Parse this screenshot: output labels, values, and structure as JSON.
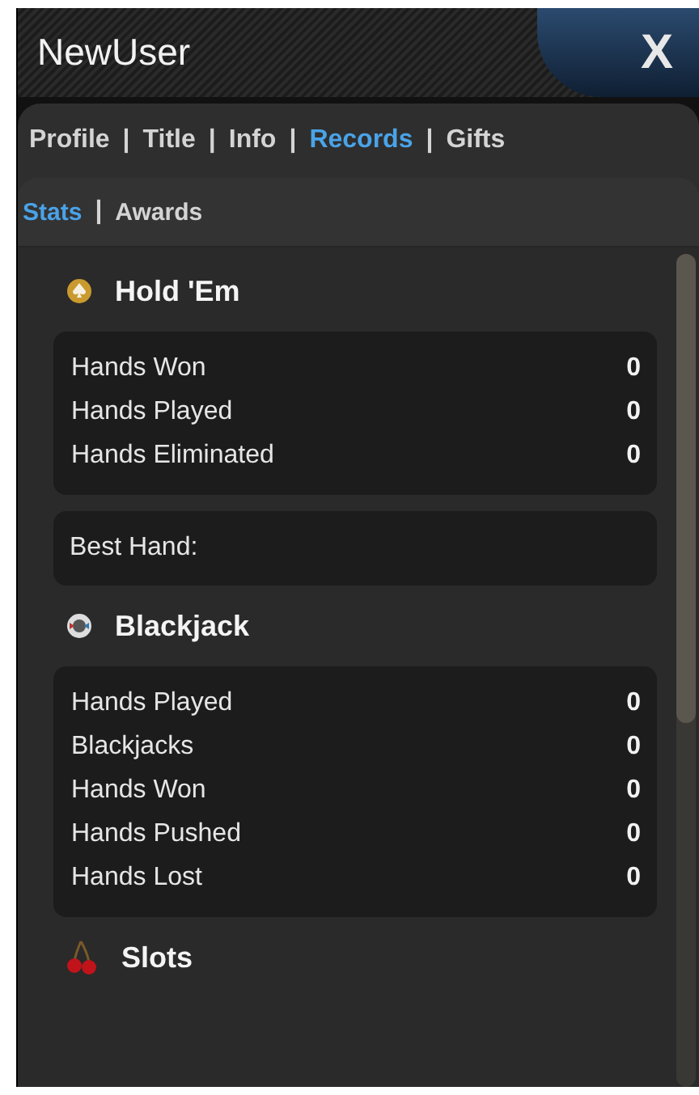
{
  "window": {
    "title": "NewUser",
    "close": "X"
  },
  "tabs": [
    {
      "label": "Profile",
      "selected": false
    },
    {
      "label": "Title",
      "selected": false
    },
    {
      "label": "Info",
      "selected": false
    },
    {
      "label": "Records",
      "selected": true
    },
    {
      "label": "Gifts",
      "selected": false
    }
  ],
  "subtabs": [
    {
      "label": "Stats",
      "selected": true
    },
    {
      "label": "Awards",
      "selected": false
    }
  ],
  "separator": "|",
  "sections": [
    {
      "title": "Hold 'Em",
      "panels": [
        {
          "kind": "stats",
          "rows": [
            {
              "label": "Hands Won",
              "value": "0"
            },
            {
              "label": "Hands Played",
              "value": "0"
            },
            {
              "label": "Hands Eliminated",
              "value": "0"
            }
          ]
        },
        {
          "kind": "text",
          "text": "Best Hand:"
        }
      ]
    },
    {
      "title": "Blackjack",
      "panels": [
        {
          "kind": "stats",
          "rows": [
            {
              "label": "Hands Played",
              "value": "0"
            },
            {
              "label": "Blackjacks",
              "value": "0"
            },
            {
              "label": "Hands Won",
              "value": "0"
            },
            {
              "label": "Hands Pushed",
              "value": "0"
            },
            {
              "label": "Hands Lost",
              "value": "0"
            }
          ]
        }
      ]
    },
    {
      "title": "Slots"
    }
  ]
}
